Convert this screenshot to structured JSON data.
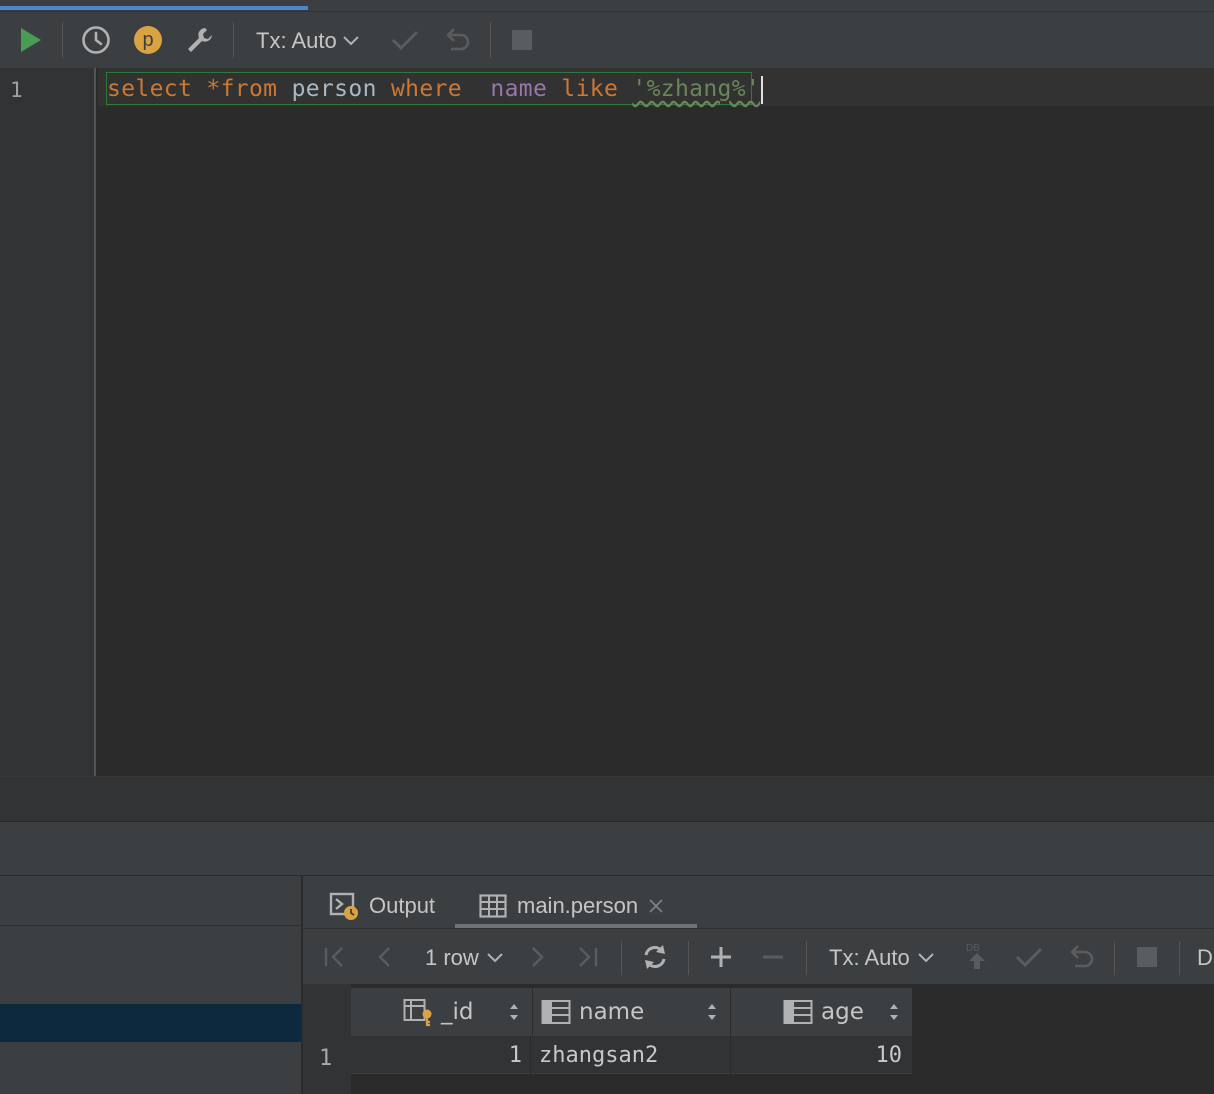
{
  "toolbar": {
    "run_icon": "play-icon",
    "history_icon": "clock-icon",
    "profile_letter": "p",
    "settings_icon": "wrench-icon",
    "tx_label": "Tx: Auto",
    "commit_icon": "check-icon",
    "rollback_icon": "undo-icon",
    "stop_icon": "stop-icon"
  },
  "editor": {
    "line_number": "1",
    "sql": {
      "t1": "select",
      "t2": " *",
      "t3": "from",
      "t4": " person ",
      "t5": "where",
      "t6": "  ",
      "t7": "name",
      "t8": " ",
      "t9": "like",
      "t10": " ",
      "t11": "'%zhang%'"
    }
  },
  "results": {
    "tabs": [
      {
        "label": "Output",
        "icon": "console-icon"
      },
      {
        "label": "main.person",
        "icon": "table-icon",
        "active": true
      }
    ],
    "toolbar": {
      "row_count": "1 row",
      "tx_label": "Tx: Auto",
      "db_badge": "DB",
      "truncated_label": "D"
    },
    "columns": [
      {
        "name": "_id",
        "icon": "primary-key-column-icon"
      },
      {
        "name": "name",
        "icon": "column-icon"
      },
      {
        "name": "age",
        "icon": "column-icon"
      }
    ],
    "rows": [
      {
        "row_number": "1",
        "id": "1",
        "name": "zhangsan2",
        "age": "10"
      }
    ]
  },
  "colors": {
    "keyword": "#cc7832",
    "identifier": "#a9b7c6",
    "column": "#9876aa",
    "string": "#6a8759",
    "run_green": "#499c54",
    "profile_orange": "#d9a343",
    "selection_blue": "#0d293e",
    "progress_blue": "#4a88c7"
  }
}
